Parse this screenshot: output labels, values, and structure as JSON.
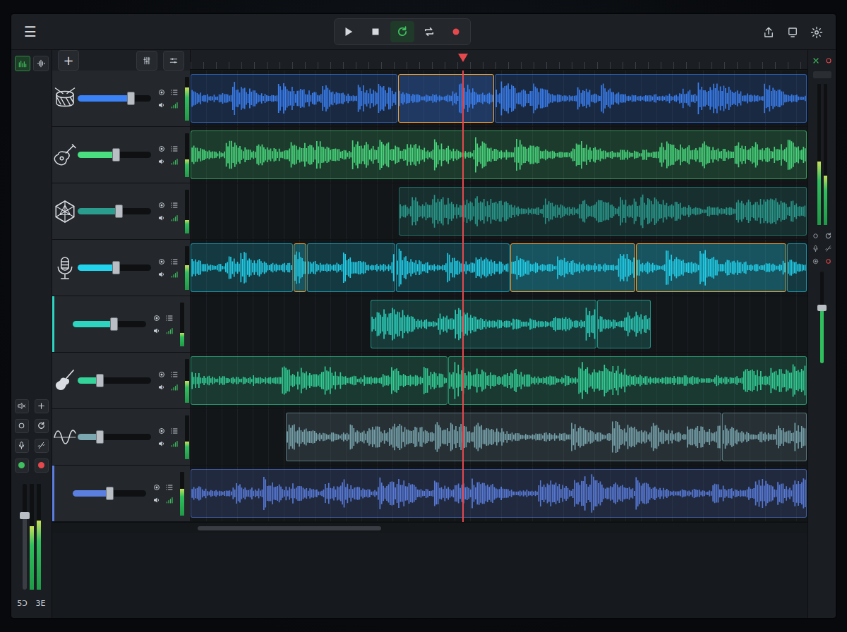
{
  "topbar": {
    "menu": "☰",
    "add": "+"
  },
  "view_toggles": [
    {
      "kind": "tracks",
      "selected": true
    },
    {
      "kind": "waveform",
      "selected": false
    }
  ],
  "transport": [
    {
      "kind": "play",
      "active": false
    },
    {
      "kind": "stop",
      "active": false
    },
    {
      "kind": "loop",
      "active": true
    },
    {
      "kind": "cycle",
      "active": false
    },
    {
      "kind": "record",
      "active": false
    }
  ],
  "tools": [
    {
      "kind": "mute"
    },
    {
      "kind": "plus"
    },
    {
      "kind": "circle"
    },
    {
      "kind": "loop"
    },
    {
      "kind": "mic"
    },
    {
      "kind": "slash"
    }
  ],
  "master": {
    "arm_green": true,
    "arm_red": true,
    "level": 0.7,
    "meters": [
      0.6,
      0.65
    ],
    "labels": [
      "5Ͻ",
      "3E"
    ]
  },
  "right_strip": {
    "meters": [
      0.45,
      0.35
    ],
    "fader": 0.6
  },
  "playhead": 0.441,
  "tracks": [
    {
      "kind": "drums",
      "color": "#3b82f6",
      "volume": 0.72,
      "meter": 0.75,
      "clips": [
        {
          "start": 0,
          "end": 0.336,
          "selected": false
        },
        {
          "start": 0.336,
          "end": 0.493,
          "selected": true
        },
        {
          "start": 0.493,
          "end": 1,
          "selected": false
        }
      ]
    },
    {
      "kind": "acoustic",
      "color": "#4ade80",
      "volume": 0.52,
      "meter": 0.4,
      "clips": [
        {
          "start": 0,
          "end": 1,
          "selected": false
        }
      ]
    },
    {
      "kind": "synth",
      "color": "#2a9d8f",
      "volume": 0.56,
      "meter": 0.3,
      "clips": [
        {
          "start": 0.338,
          "end": 1,
          "selected": false
        }
      ]
    },
    {
      "kind": "vocal",
      "color": "#22d3ee",
      "volume": 0.52,
      "meter": 0.55,
      "clips": [
        {
          "start": 0,
          "end": 0.167,
          "selected": false
        },
        {
          "start": 0.167,
          "end": 0.189,
          "selected": true
        },
        {
          "start": 0.189,
          "end": 0.333,
          "selected": false
        },
        {
          "start": 0.333,
          "end": 0.518,
          "selected": false
        },
        {
          "start": 0.518,
          "end": 0.722,
          "selected": true
        },
        {
          "start": 0.722,
          "end": 0.967,
          "selected": true
        },
        {
          "start": 0.967,
          "end": 1,
          "selected": false
        }
      ]
    },
    {
      "kind": "none",
      "color": "#2dd4bf",
      "volume": 0.56,
      "meter": 0.3,
      "clips": [
        {
          "start": 0.292,
          "end": 0.659,
          "selected": false
        },
        {
          "start": 0.659,
          "end": 0.747,
          "selected": false
        }
      ]
    },
    {
      "kind": "electric",
      "color": "#34d399",
      "volume": 0.3,
      "meter": 0.5,
      "clips": [
        {
          "start": 0,
          "end": 0.418,
          "selected": false
        },
        {
          "start": 0.418,
          "end": 1,
          "selected": false
        }
      ]
    },
    {
      "kind": "wave",
      "color": "#7ba7b0",
      "volume": 0.3,
      "meter": 0.4,
      "clips": [
        {
          "start": 0.155,
          "end": 0.862,
          "selected": false
        },
        {
          "start": 0.862,
          "end": 1,
          "selected": false
        }
      ]
    },
    {
      "kind": "none",
      "color": "#5b7fe0",
      "volume": 0.5,
      "meter": 0.6,
      "clips": [
        {
          "start": 0,
          "end": 1,
          "selected": false
        }
      ]
    }
  ]
}
